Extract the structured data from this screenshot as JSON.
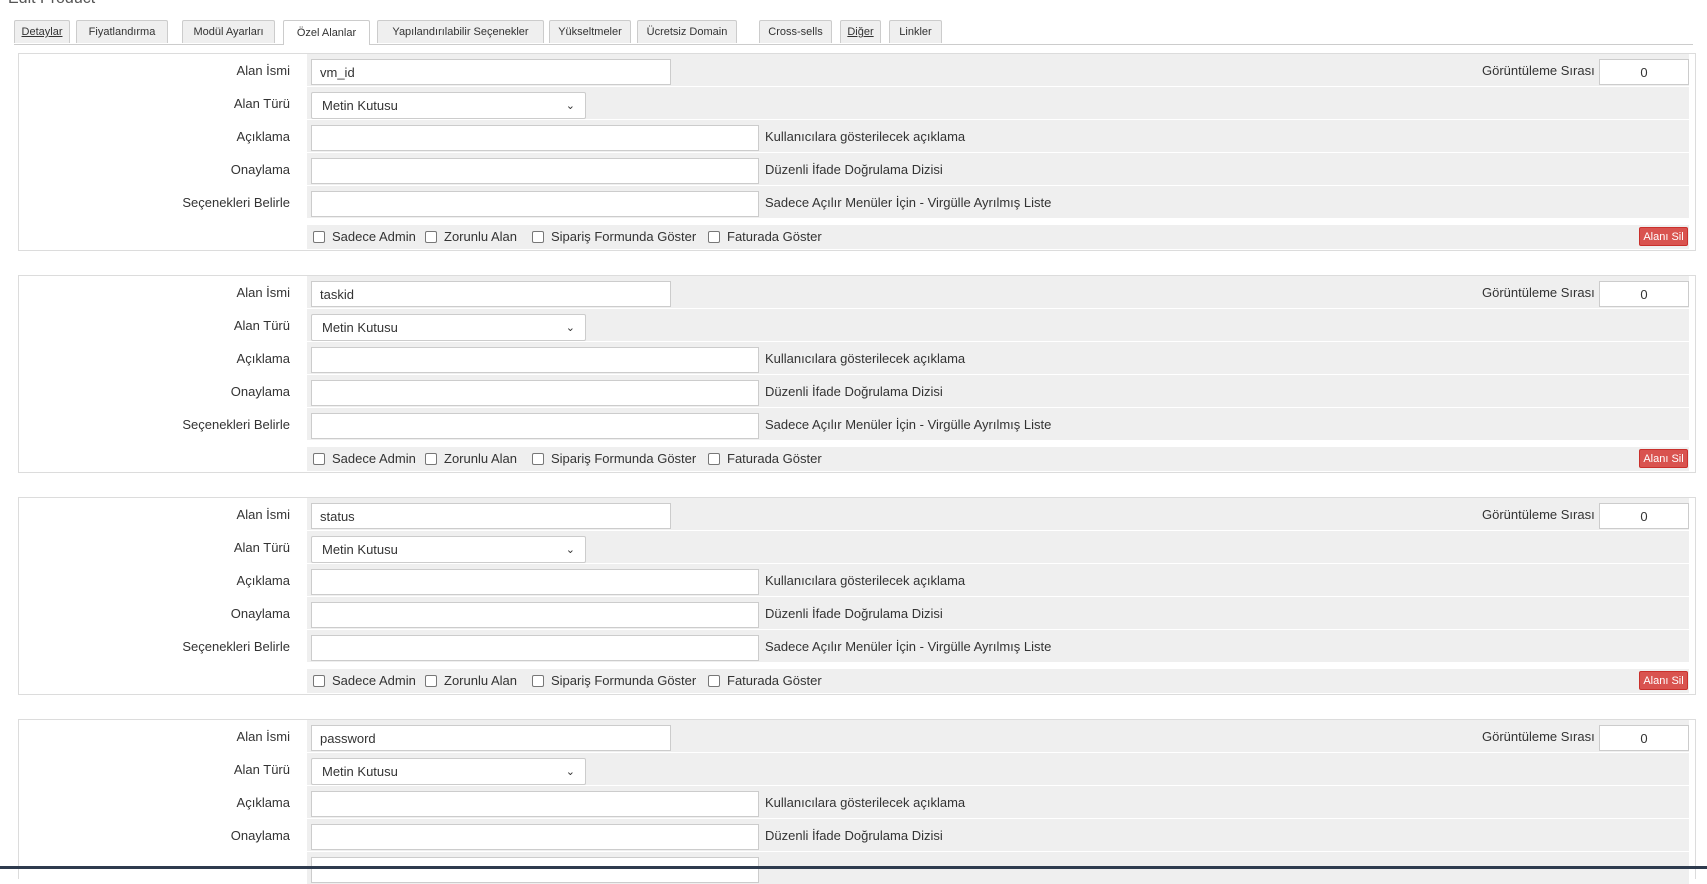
{
  "page": {
    "heading": "Edit Product"
  },
  "tabs": [
    {
      "label": "Detaylar"
    },
    {
      "label": "Fiyatlandırma"
    },
    {
      "label": "Modül Ayarları"
    },
    {
      "label": "Özel Alanlar"
    },
    {
      "label": "Yapılandırılabilir Seçenekler"
    },
    {
      "label": "Yükseltmeler"
    },
    {
      "label": "Ücretsiz Domain"
    },
    {
      "label": "Cross-sells"
    },
    {
      "label": "Diğer"
    },
    {
      "label": "Linkler"
    }
  ],
  "labels": {
    "field_name": "Alan İsmi",
    "field_type": "Alan Türü",
    "description": "Açıklama",
    "validation": "Onaylama",
    "options": "Seçenekleri Belirle",
    "display_order": "Görüntüleme Sırası",
    "desc_hint": "Kullanıcılara gösterilecek açıklama",
    "validation_hint": "Düzenli İfade Doğrulama Dizisi",
    "options_hint": "Sadece Açılır Menüler İçin - Virgülle Ayrılmış Liste",
    "admin_only": "Sadece Admin",
    "required": "Zorunlu Alan",
    "show_order": "Sipariş Formunda Göster",
    "show_invoice": "Faturada Göster",
    "delete": "Alanı Sil"
  },
  "fields": [
    {
      "name": "vm_id",
      "type": "Metin Kutusu",
      "order": "0"
    },
    {
      "name": "taskid",
      "type": "Metin Kutusu",
      "order": "0"
    },
    {
      "name": "status",
      "type": "Metin Kutusu",
      "order": "0"
    },
    {
      "name": "password",
      "type": "Metin Kutusu",
      "order": "0"
    }
  ]
}
